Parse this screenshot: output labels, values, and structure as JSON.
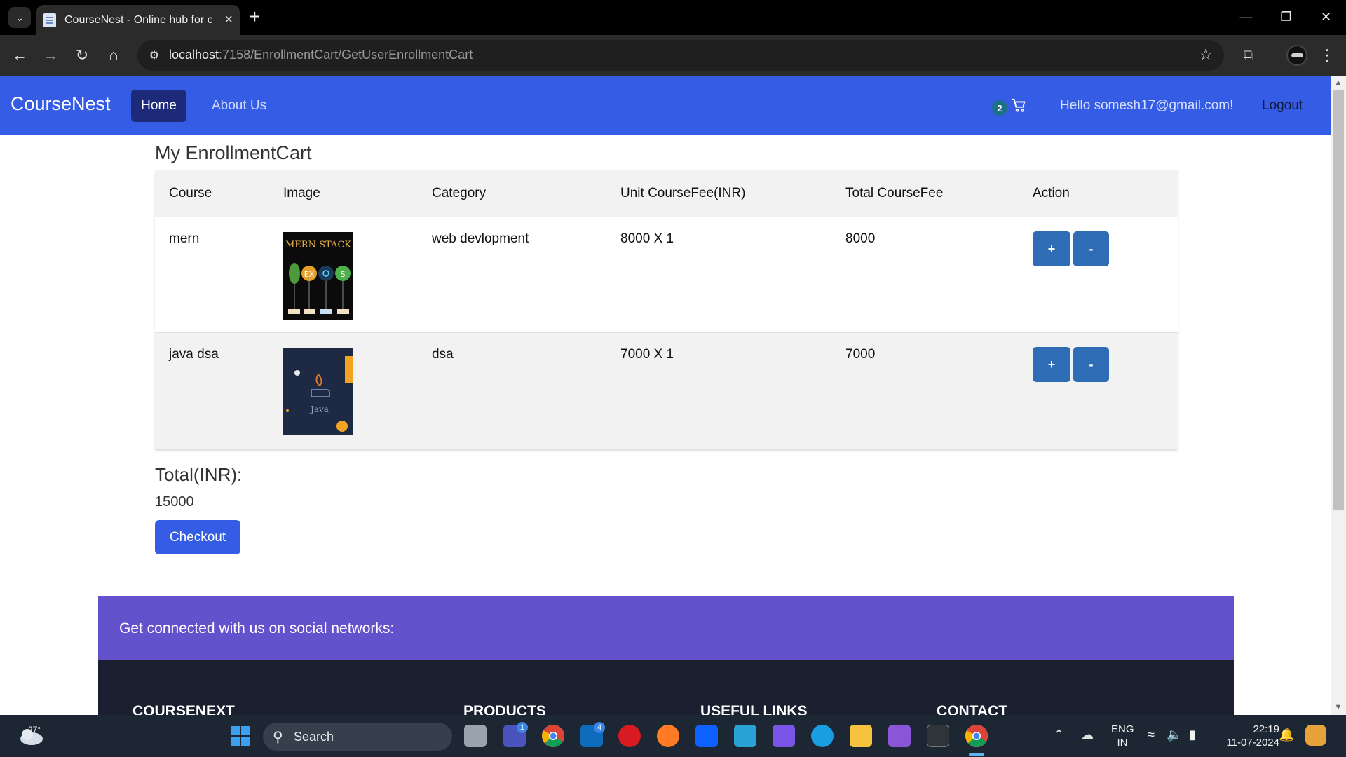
{
  "browser": {
    "tab_title": "CourseNest - Online hub for co",
    "url_host": "localhost",
    "url_rest": ":7158/EnrollmentCart/GetUserEnrollmentCart"
  },
  "navbar": {
    "brand": "CourseNest",
    "home": "Home",
    "about": "About Us",
    "cart_count": "2",
    "greeting": "Hello somesh17@gmail.com!",
    "logout": "Logout"
  },
  "cart": {
    "title": "My EnrollmentCart",
    "headers": [
      "Course",
      "Image",
      "Category",
      "Unit CourseFee(INR)",
      "Total CourseFee",
      "Action"
    ],
    "rows": [
      {
        "course": "mern",
        "category": "web devlopment",
        "unit_fee": "8000 X 1",
        "total_fee": "8000",
        "image_label": "MERN STACK",
        "plus": "+",
        "minus": "-"
      },
      {
        "course": "java dsa",
        "category": "dsa",
        "unit_fee": "7000 X 1",
        "total_fee": "7000",
        "image_label": "Java",
        "plus": "+",
        "minus": "-"
      }
    ],
    "total_label": "Total(INR):",
    "total_value": "15000",
    "checkout": "Checkout"
  },
  "footer": {
    "social": "Get connected with us on social networks:",
    "headings": [
      "COURSENEXT",
      "PRODUCTS",
      "USEFUL LINKS",
      "CONTACT"
    ]
  },
  "taskbar": {
    "temperature": "27°",
    "search": "Search",
    "teams_badge": "1",
    "mail_badge": "4",
    "lang": "ENG",
    "region": "IN",
    "time": "22:19",
    "date": "11-07-2024"
  },
  "colors": {
    "navbar": "#355ce4",
    "home_active": "#1d2a7a",
    "action_button": "#2e6db5",
    "social_band": "#6451cc",
    "footer_dark": "#1b2030"
  }
}
